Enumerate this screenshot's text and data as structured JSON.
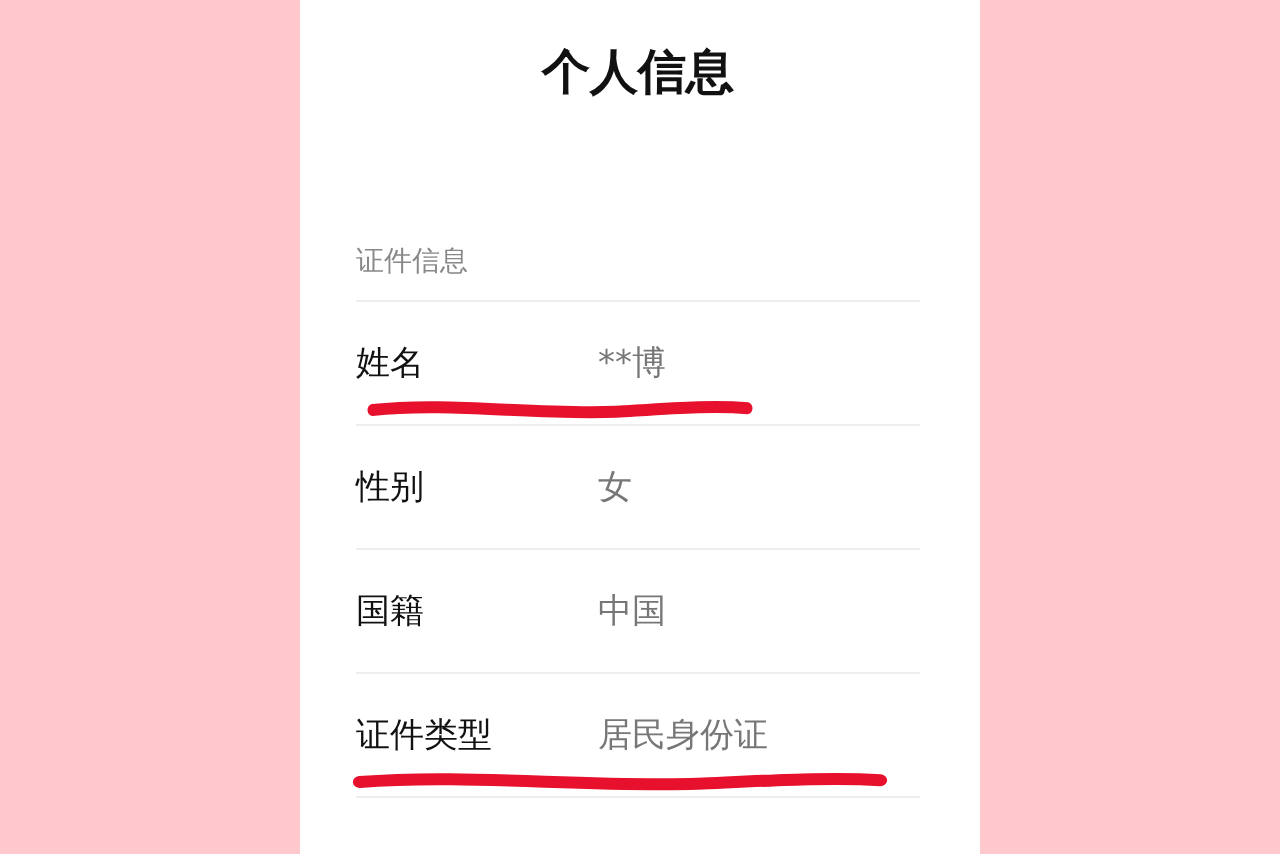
{
  "page": {
    "title": "个人信息"
  },
  "section": {
    "label": "证件信息"
  },
  "rows": [
    {
      "label": "姓名",
      "value": "**博",
      "underlined": true
    },
    {
      "label": "性别",
      "value": "女",
      "underlined": false
    },
    {
      "label": "国籍",
      "value": "中国",
      "underlined": false
    },
    {
      "label": "证件类型",
      "value": "居民身份证",
      "underlined": true
    }
  ]
}
